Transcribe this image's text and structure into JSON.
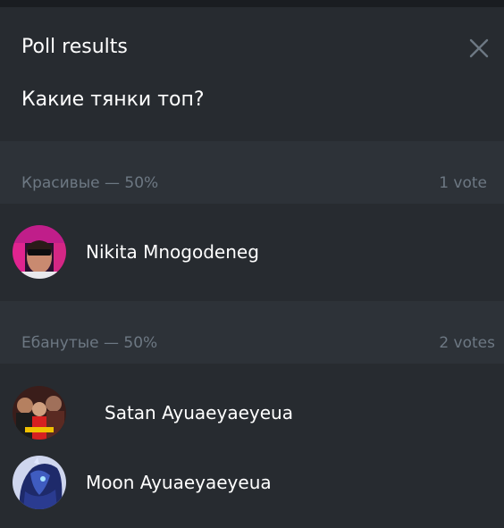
{
  "dialog": {
    "title": "Poll results",
    "question": "Какие тянки топ?",
    "close_icon": "close-icon"
  },
  "options": [
    {
      "label": "Красивые — 50%",
      "votes": "1 vote",
      "voters": [
        {
          "name": "Nikita Mnogodeneg",
          "avatar": "avatar-neon-sunglasses"
        }
      ]
    },
    {
      "label": "Ебанутые — 50%",
      "votes": "2 votes",
      "voters": [
        {
          "name": "Satan Ayuaeyaeyeua",
          "avatar": "avatar-group-red"
        },
        {
          "name": "Moon Ayuaeyaeyeua",
          "avatar": "avatar-blue-pony"
        }
      ]
    }
  ],
  "colors": {
    "background": "#272b30",
    "option_header_bg": "#2d3238",
    "muted_text": "#6d7883",
    "text": "#ffffff"
  }
}
